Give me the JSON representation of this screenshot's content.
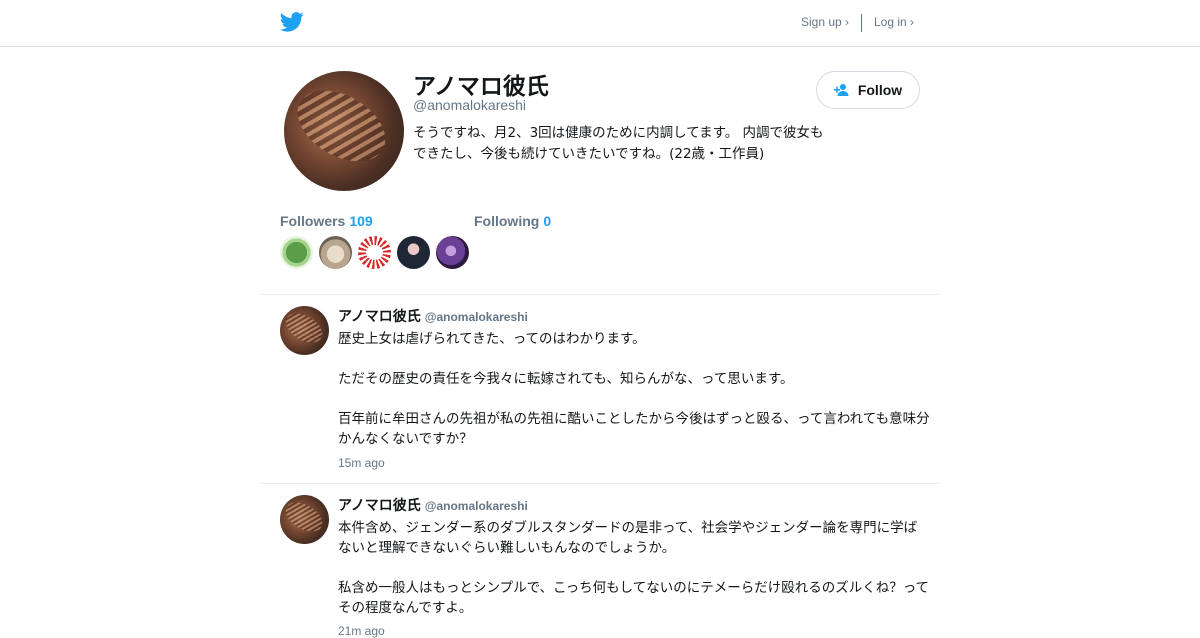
{
  "header": {
    "logo_icon": "twitter-bird-icon",
    "signup_label": "Sign up ›",
    "login_label": "Log in ›",
    "brand_color": "#1da1f2"
  },
  "profile": {
    "name": "アノマロ彼氏",
    "handle": "@anomalokareshi",
    "bio": "そうですね、月2、3回は健康のために内調してます。 内調で彼女もできたし、今後も続けていきたいですね。(22歳・工作員)",
    "follow_label": "Follow",
    "follow_icon": "add-user-icon",
    "followers_label": "Followers",
    "followers_count": "109",
    "following_label": "Following",
    "following_count": "0"
  },
  "tweets": [
    {
      "name": "アノマロ彼氏",
      "handle": "@anomalokareshi",
      "text": "歴史上女は虐げられてきた、ってのはわかります。\n\nただその歴史の責任を今我々に転嫁されても、知らんがな、って思います。\n\n百年前に牟田さんの先祖が私の先祖に酷いことしたから今後はずっと殴る、って言われても意味分かんなくないですか？",
      "time": "15m ago"
    },
    {
      "name": "アノマロ彼氏",
      "handle": "@anomalokareshi",
      "text": "本件含め、ジェンダー系のダブルスタンダードの是非って、社会学やジェンダー論を専門に学ばないと理解できないぐらい難しいもんなのでしょうか。\n\n私含め一般人はもっとシンプルで、こっち何もしてないのにテメーらだけ殴れるのズルくね？ってその程度なんですよ。",
      "time": "21m ago"
    }
  ]
}
